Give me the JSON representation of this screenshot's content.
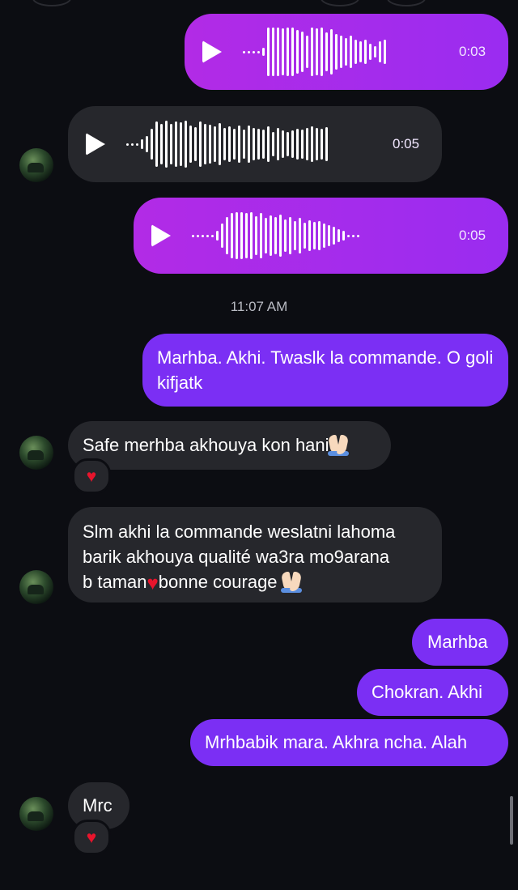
{
  "messages": {
    "voice1": {
      "duration": "0:03"
    },
    "voice2": {
      "duration": "0:05"
    },
    "voice3": {
      "duration": "0:05"
    },
    "timestamp": "11:07 AM",
    "m1": {
      "text": "Marhba. Akhi. Twaslk la commande. O goli kifjatk"
    },
    "m2": {
      "text": "Safe merhba akhouya kon hani",
      "reaction": "heart"
    },
    "m3": {
      "line1": "Slm akhi la commande weslatni lahoma",
      "line2": "barik akhouya qualité wa3ra mo9arana",
      "line3_a": "b taman",
      "line3_b": "bonne courage "
    },
    "m4": {
      "text": "Marhba"
    },
    "m5": {
      "text": "Chokran. Akhi"
    },
    "m6": {
      "text": "Mrhbabik mara. Akhra ncha. Alah"
    },
    "m7": {
      "text": "Mrc",
      "reaction": "heart"
    }
  },
  "colors": {
    "background": "#0c0d12",
    "sent_bubble": "#7b2ff4",
    "sent_voice_bubble": "#a82ce9",
    "received_bubble": "#26272c",
    "reaction_heart": "#e8142c"
  },
  "icons": {
    "play": "play-icon",
    "reaction": "red-heart",
    "emoji": "folded-hands"
  }
}
